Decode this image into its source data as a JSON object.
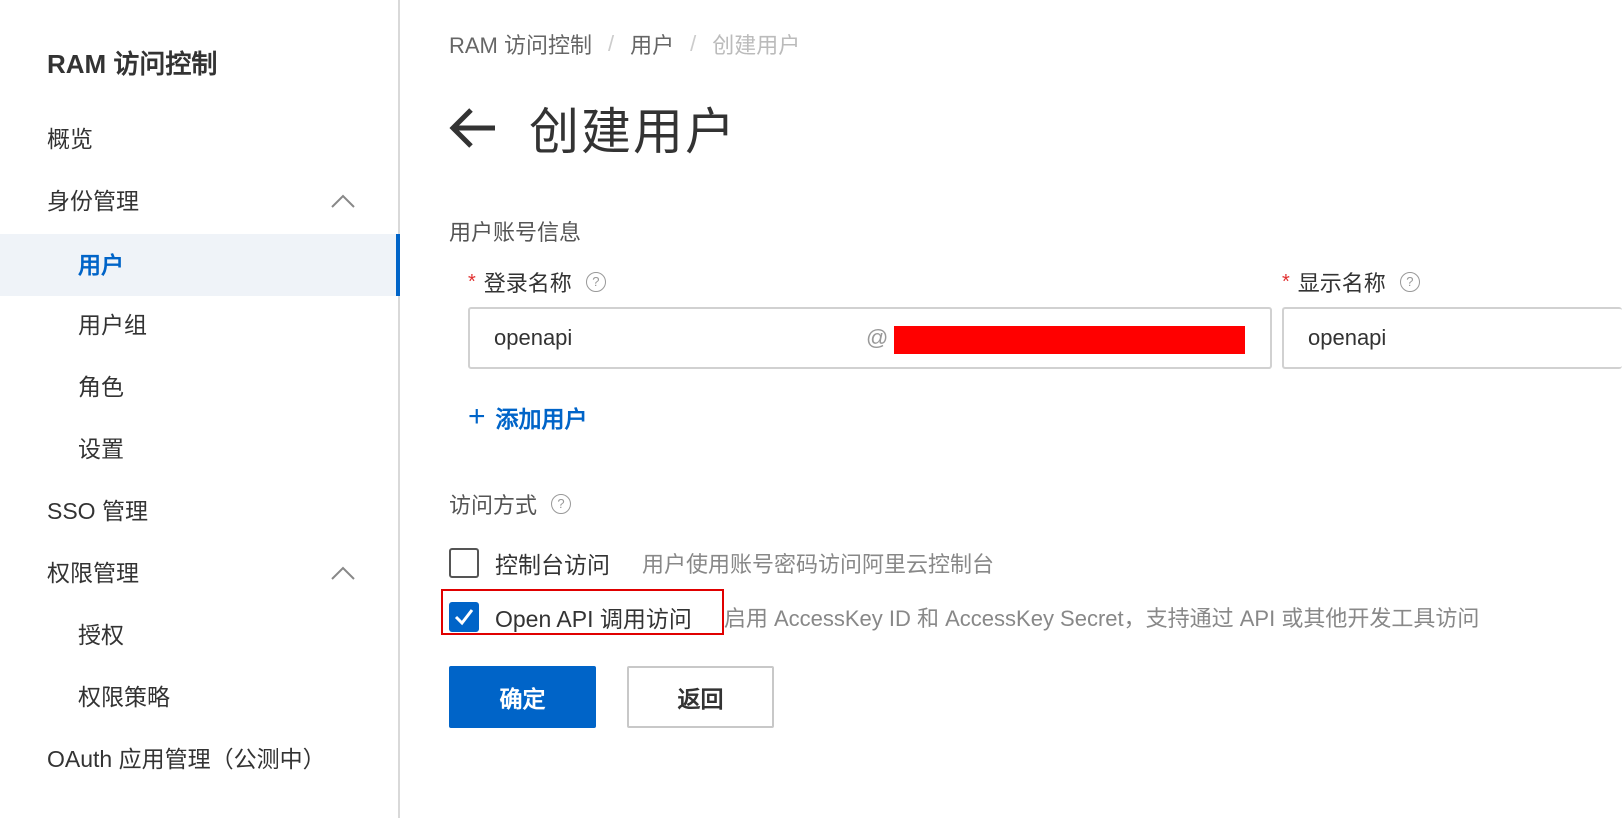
{
  "sidebar": {
    "title": "RAM 访问控制",
    "items": [
      {
        "label": "概览"
      },
      {
        "label": "身份管理"
      },
      {
        "label": "用户"
      },
      {
        "label": "用户组"
      },
      {
        "label": "角色"
      },
      {
        "label": "设置"
      },
      {
        "label": "SSO 管理"
      },
      {
        "label": "权限管理"
      },
      {
        "label": "授权"
      },
      {
        "label": "权限策略"
      },
      {
        "label": "OAuth 应用管理（公测中）"
      }
    ],
    "active_item": "用户"
  },
  "breadcrumb": [
    "RAM 访问控制",
    "用户",
    "创建用户"
  ],
  "breadcrumb_sep": "/",
  "page_title": "创建用户",
  "account_section": {
    "label": "用户账号信息",
    "login_name": {
      "label": "登录名称",
      "value": "openapi",
      "suffix": "@"
    },
    "display_name": {
      "label": "显示名称",
      "value": "openapi"
    },
    "required_mark": "*",
    "help_glyph": "?",
    "add_user_label": "添加用户",
    "add_user_icon": "+"
  },
  "access_section": {
    "label": "访问方式",
    "options": [
      {
        "label": "控制台访问",
        "desc": "用户使用账号密码访问阿里云控制台",
        "checked": false
      },
      {
        "label": "Open API 调用访问",
        "desc": "启用 AccessKey ID 和 AccessKey Secret，支持通过 API 或其他开发工具访问",
        "checked": true
      }
    ]
  },
  "actions": {
    "confirm": "确定",
    "back": "返回"
  },
  "colors": {
    "primary": "#0064c8",
    "required": "#e12f2f",
    "highlight": "#e00000",
    "redaction": "#ff0000"
  }
}
